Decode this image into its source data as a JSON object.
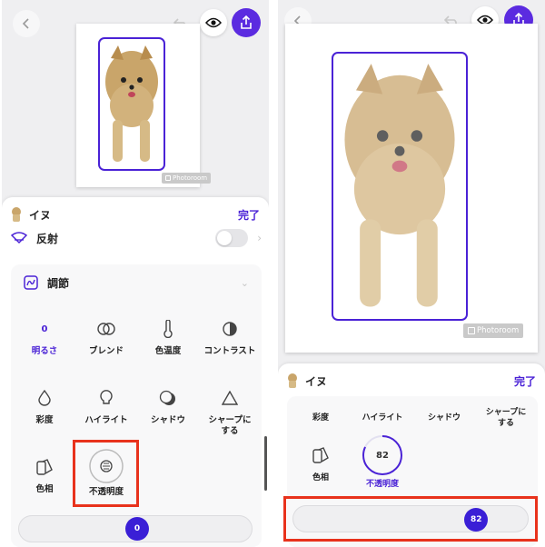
{
  "layer": {
    "name": "イヌ",
    "done_label": "完了"
  },
  "watermark": "Photoroom",
  "left": {
    "reflect_label": "反射",
    "adjust_title": "調節",
    "tools": [
      {
        "label": "明るさ",
        "icon": "brightness-icon",
        "value": "0",
        "active": true
      },
      {
        "label": "ブレンド",
        "icon": "blend-icon"
      },
      {
        "label": "色温度",
        "icon": "thermometer-icon"
      },
      {
        "label": "コントラスト",
        "icon": "contrast-icon"
      },
      {
        "label": "彩度",
        "icon": "drop-icon"
      },
      {
        "label": "ハイライト",
        "icon": "lightbulb-icon"
      },
      {
        "label": "シャドウ",
        "icon": "shadow-icon"
      },
      {
        "label": "シャープにする",
        "label_lines": [
          "シャープに",
          "する"
        ],
        "icon": "triangle-icon"
      },
      {
        "label": "色相",
        "icon": "hue-icon"
      },
      {
        "label": "不透明度",
        "icon": "opacity-icon"
      }
    ],
    "slider_value": "0"
  },
  "right": {
    "tools": [
      {
        "label": "彩度"
      },
      {
        "label": "ハイライト"
      },
      {
        "label": "シャドウ"
      },
      {
        "label": "シャープにする",
        "label_lines": [
          "シャープに",
          "する"
        ]
      },
      {
        "label": "色相",
        "icon": "hue-icon"
      },
      {
        "label": "不透明度",
        "icon": "opacity-ring-icon",
        "value": "82",
        "active": true
      }
    ],
    "opacity_fraction": 0.82,
    "slider_value": "82"
  },
  "colors": {
    "accent": "#4a22d6",
    "highlight": "#e8321c",
    "share": "#5b2be0"
  }
}
